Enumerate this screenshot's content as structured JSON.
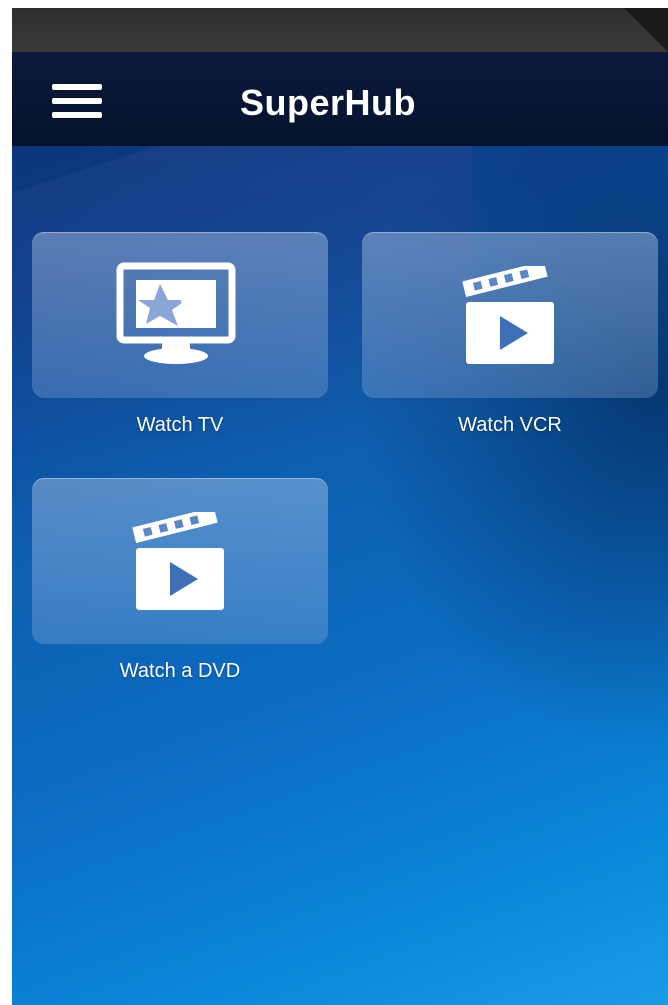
{
  "app": {
    "title": "SuperHub"
  },
  "header": {
    "menu_icon": "hamburger-menu-icon"
  },
  "tiles": [
    {
      "label": "Watch TV",
      "icon": "tv-icon"
    },
    {
      "label": "Watch VCR",
      "icon": "clapperboard-icon"
    },
    {
      "label": "Watch a DVD",
      "icon": "clapperboard-icon"
    }
  ],
  "colors": {
    "nav_bar": "#06122c",
    "background_top": "#0a2a6a",
    "background_bottom": "#1a9be6",
    "text": "#ffffff"
  }
}
